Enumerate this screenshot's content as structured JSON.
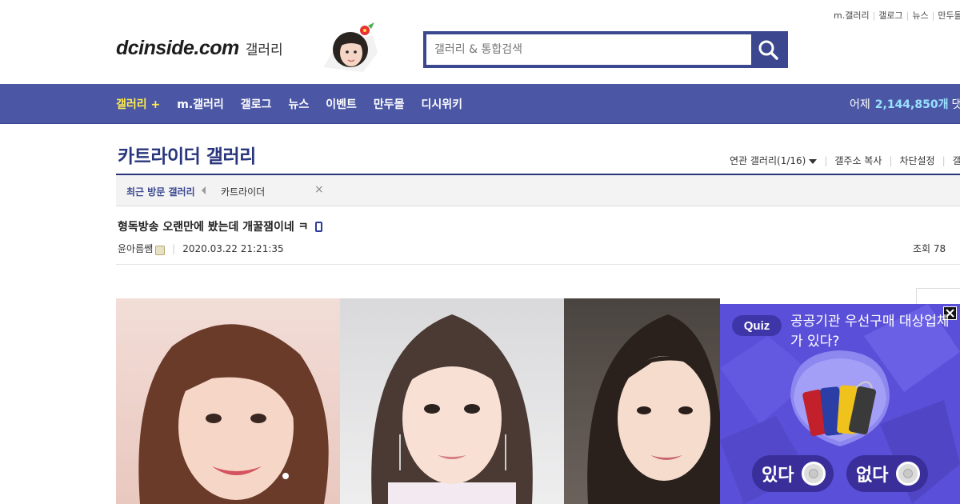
{
  "top_links": [
    "m.갤러리",
    "갤로그",
    "뉴스",
    "만두몰"
  ],
  "logo": {
    "main": "dcinside.com",
    "sub": "갤러리"
  },
  "search": {
    "placeholder": "갤러리 & 통합검색"
  },
  "nav": {
    "items": [
      "갤러리 +",
      "m.갤러리",
      "갤로그",
      "뉴스",
      "이벤트",
      "만두몰",
      "디시위키"
    ],
    "right_prefix": "어제",
    "right_count": "2,144,850개",
    "right_suffix": "댓글"
  },
  "gallery": {
    "title": "카트라이더 갤러리",
    "actions": [
      "연관 갤러리(1/16)",
      "갤주소 복사",
      "차단설정",
      "갤러"
    ]
  },
  "recent": {
    "label": "최근 방문 갤러리",
    "item": "카트라이더",
    "close": "×"
  },
  "post": {
    "title": "형독방송 오랜만에 봤는데 개꿀잼이네 ㅋ",
    "author": "윤아름쌤",
    "datetime": "2020.03.22 21:21:35",
    "views": "조회 78"
  },
  "ad": {
    "badge": "Quiz",
    "question": "공공기관 우선구매 대상업체가 있다?",
    "yes": "있다",
    "no": "없다"
  },
  "colors": {
    "brand": "#3b4890",
    "nav": "#4b57a5",
    "count": "#99e2ff",
    "active": "#ffed4e",
    "ad_bg": "#5a4fd8"
  }
}
